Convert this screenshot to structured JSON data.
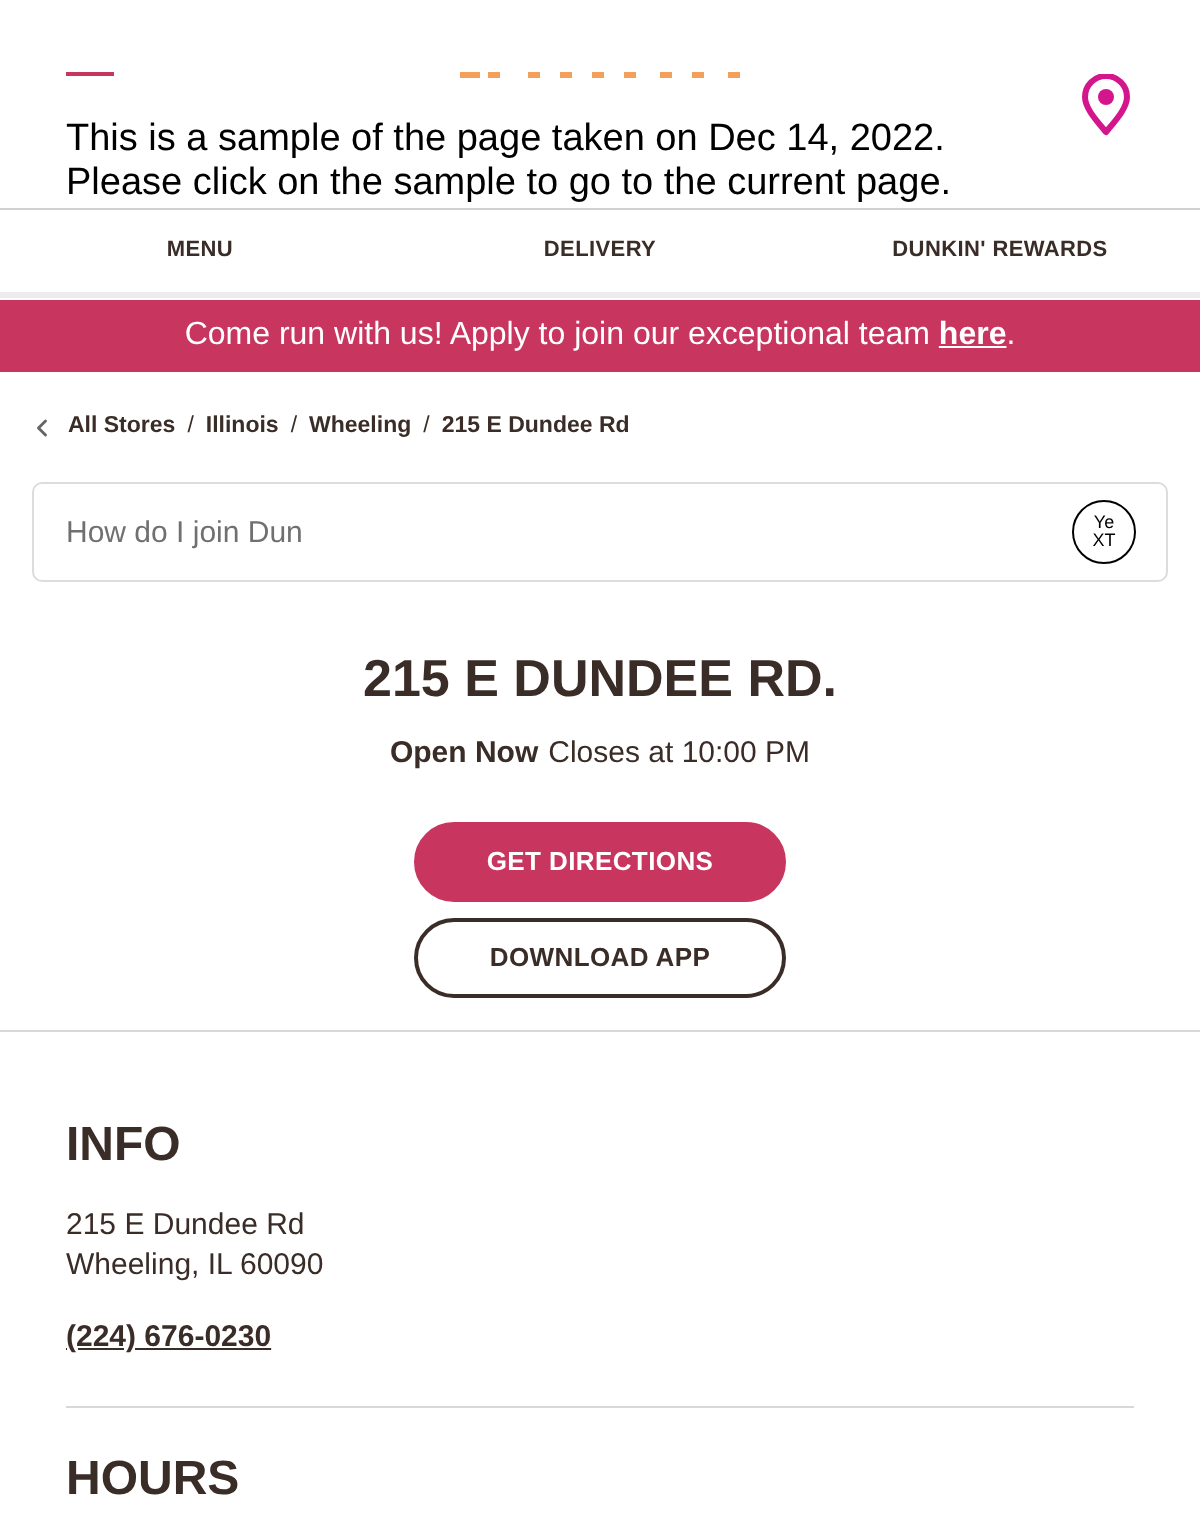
{
  "header": {
    "notice": [
      "This is a sample of the page taken on Dec 14, 2022.",
      "Please click on the sample to go to the current page."
    ]
  },
  "nav": [
    {
      "label": "MENU"
    },
    {
      "label": "DELIVERY"
    },
    {
      "label": "DUNKIN' REWARDS"
    }
  ],
  "banner": {
    "text": "Come run with us! Apply to join our exceptional team",
    "link": "here",
    "end": "."
  },
  "breadcrumb": {
    "separator": "/",
    "items": [
      "All Stores",
      "Illinois",
      "Wheeling",
      "215 E Dundee Rd"
    ]
  },
  "search": {
    "placeholder": "How do I join Dun",
    "logo_lines": [
      "Ye",
      "XT"
    ]
  },
  "store": {
    "title": "215 E DUNDEE RD.",
    "status": "Open Now",
    "closes": "Closes at 10:00 PM"
  },
  "buttons": [
    {
      "label": "GET DIRECTIONS",
      "kind": "primary"
    },
    {
      "label": "DOWNLOAD APP",
      "kind": "outline"
    }
  ],
  "info": {
    "heading": "INFO",
    "address": [
      "215 E Dundee Rd",
      "Wheeling, IL 60090"
    ],
    "phone": "(224) 676-0230"
  },
  "hours": {
    "heading": "HOURS"
  }
}
